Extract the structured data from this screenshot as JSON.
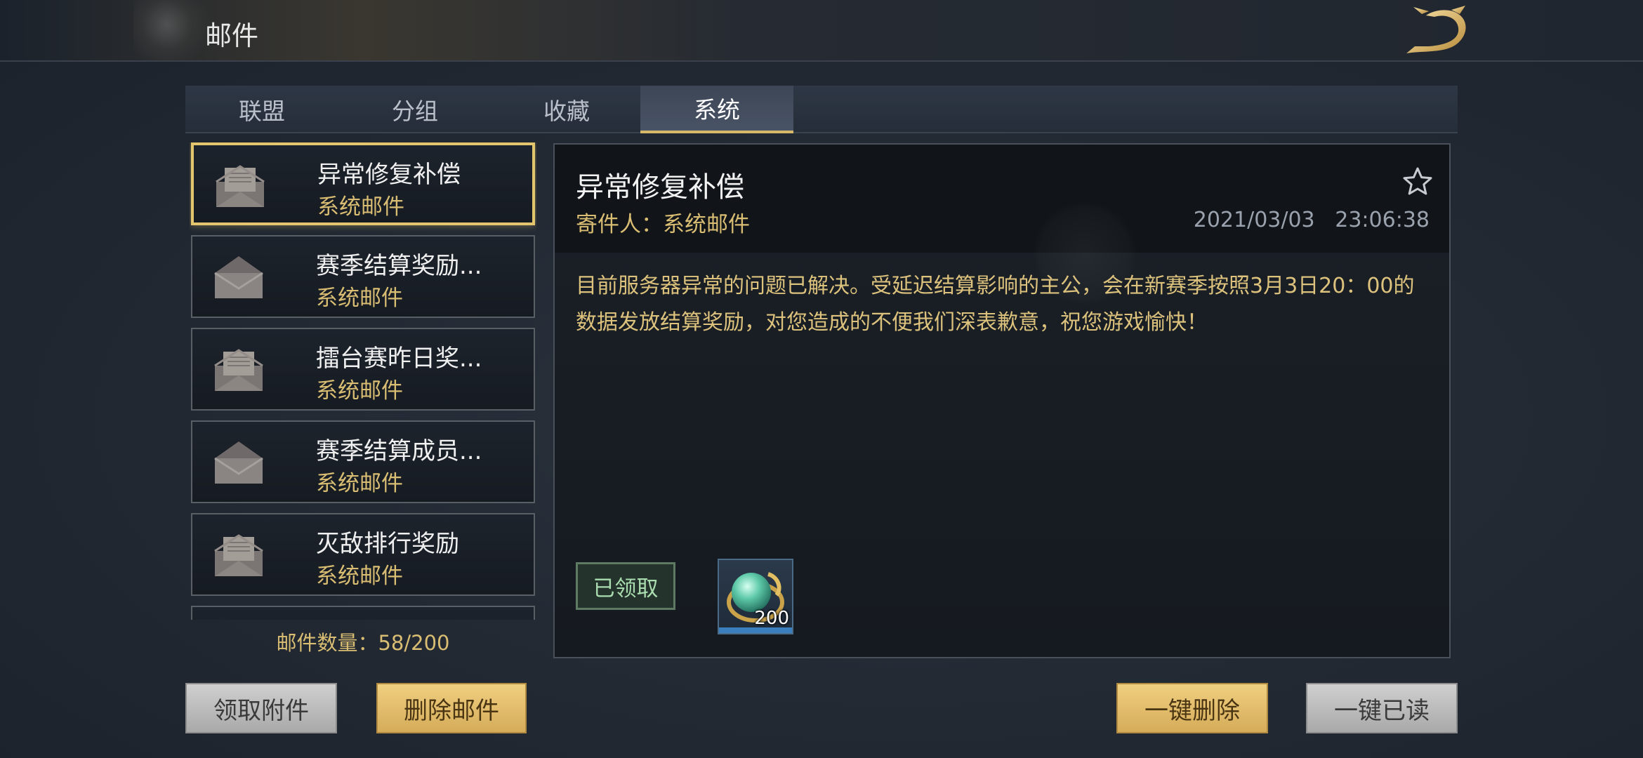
{
  "header": {
    "title": "邮件"
  },
  "tabs": [
    {
      "label": "联盟",
      "active": false
    },
    {
      "label": "分组",
      "active": false
    },
    {
      "label": "收藏",
      "active": false
    },
    {
      "label": "系统",
      "active": true
    }
  ],
  "mail_list": {
    "items": [
      {
        "title": "异常修复补偿",
        "sender": "系统邮件",
        "icon": "open-envelope-icon",
        "selected": true
      },
      {
        "title": "赛季结算奖励...",
        "sender": "系统邮件",
        "icon": "read-envelope-icon",
        "selected": false
      },
      {
        "title": "擂台赛昨日奖...",
        "sender": "系统邮件",
        "icon": "open-envelope-icon",
        "selected": false
      },
      {
        "title": "赛季结算成员...",
        "sender": "系统邮件",
        "icon": "read-envelope-icon",
        "selected": false
      },
      {
        "title": "灭敌排行奖励",
        "sender": "系统邮件",
        "icon": "open-envelope-icon",
        "selected": false
      }
    ],
    "count_text": "邮件数量：58/200"
  },
  "detail": {
    "title": "异常修复补偿",
    "sender": "寄件人：系统邮件",
    "datetime": "2021/03/03   23:06:38",
    "body": "目前服务器异常的问题已解决。受延迟结算影响的主公，会在新赛季按照3月3日20：00的数据发放结算奖励，对您造成的不便我们深表歉意，祝您游戏愉快！",
    "claimed_label": "已领取",
    "attachment": {
      "icon": "jade-ring-icon",
      "quantity": "200"
    }
  },
  "buttons": {
    "claim_attachments": "领取附件",
    "delete_mail": "删除邮件",
    "delete_all": "一键删除",
    "read_all": "一键已读"
  },
  "colors": {
    "accent_gold": "#d9bd73",
    "selected_border": "#e3c56e",
    "claimed_green": "#a9dcae"
  }
}
